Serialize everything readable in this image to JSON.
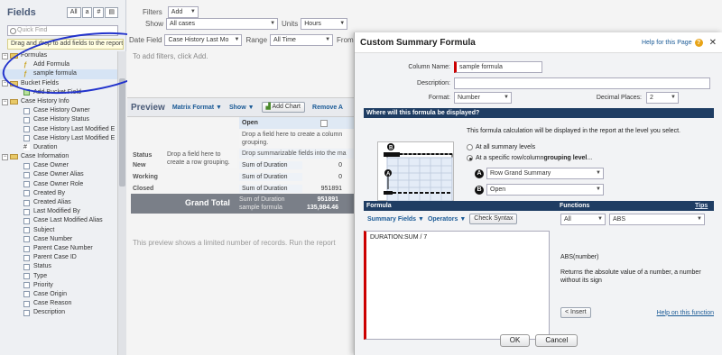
{
  "sidebar": {
    "title": "Fields",
    "filter_buttons": [
      "All",
      "a",
      "#",
      "▤"
    ],
    "quick_find_placeholder": "Quick Find",
    "drag_tip": "Drag and drop to add fields to the report",
    "tree": [
      {
        "label": "Formulas",
        "level": 0,
        "kind": "folder",
        "toggle": "⊟"
      },
      {
        "label": "Add Formula",
        "level": 1,
        "kind": "formula"
      },
      {
        "label": "sample formula",
        "level": 1,
        "kind": "formula",
        "selected": true
      },
      {
        "label": "Bucket Fields",
        "level": 0,
        "kind": "folder",
        "toggle": "⊟"
      },
      {
        "label": "Add Bucket Field",
        "level": 1,
        "kind": "bucket"
      },
      {
        "label": "Case History Info",
        "level": 0,
        "kind": "folder",
        "toggle": "⊟"
      },
      {
        "label": "Case History Owner",
        "level": 1,
        "kind": "field"
      },
      {
        "label": "Case History Status",
        "level": 1,
        "kind": "field"
      },
      {
        "label": "Case History Last Modified E",
        "level": 1,
        "kind": "field"
      },
      {
        "label": "Case History Last Modified E",
        "level": 1,
        "kind": "field"
      },
      {
        "label": "Duration",
        "level": 1,
        "kind": "num"
      },
      {
        "label": "Case Information",
        "level": 0,
        "kind": "folder",
        "toggle": "⊟"
      },
      {
        "label": "Case Owner",
        "level": 1,
        "kind": "field"
      },
      {
        "label": "Case Owner Alias",
        "level": 1,
        "kind": "field"
      },
      {
        "label": "Case Owner Role",
        "level": 1,
        "kind": "field"
      },
      {
        "label": "Created By",
        "level": 1,
        "kind": "field"
      },
      {
        "label": "Created Alias",
        "level": 1,
        "kind": "field"
      },
      {
        "label": "Last Modified By",
        "level": 1,
        "kind": "field"
      },
      {
        "label": "Case Last Modified Alias",
        "level": 1,
        "kind": "field"
      },
      {
        "label": "Subject",
        "level": 1,
        "kind": "field"
      },
      {
        "label": "Case Number",
        "level": 1,
        "kind": "field"
      },
      {
        "label": "Parent Case Number",
        "level": 1,
        "kind": "field"
      },
      {
        "label": "Parent Case ID",
        "level": 1,
        "kind": "field"
      },
      {
        "label": "Status",
        "level": 1,
        "kind": "field"
      },
      {
        "label": "Type",
        "level": 1,
        "kind": "field"
      },
      {
        "label": "Priority",
        "level": 1,
        "kind": "field"
      },
      {
        "label": "Case Origin",
        "level": 1,
        "kind": "field"
      },
      {
        "label": "Case Reason",
        "level": 1,
        "kind": "field"
      },
      {
        "label": "Description",
        "level": 1,
        "kind": "field"
      }
    ]
  },
  "main": {
    "filters_label": "Filters",
    "add_button": "Add",
    "show_label": "Show",
    "show_value": "All cases",
    "units_label": "Units",
    "units_value": "Hours",
    "date_field_label": "Date Field",
    "date_field_value": "Case History Last Mo",
    "range_label": "Range",
    "range_value": "All Time",
    "from_label": "From",
    "filters_hint": "To add filters, click Add.",
    "preview_title": "Preview",
    "format_link": "Matrix Format",
    "show_link": "Show",
    "add_chart": "Add Chart",
    "remove_link": "Remove A",
    "grid": {
      "col_header": "Open",
      "drop_col_hint": "Drop a field here to create a column grouping.",
      "drop_row_hint": "Drop a field here to create a row grouping.",
      "drop_summary_hint": "Drop summarizable fields into the ma",
      "status_label": "Status",
      "rows": [
        {
          "label": "New",
          "summary": "Sum of Duration",
          "value": "0"
        },
        {
          "label": "Working",
          "summary": "Sum of Duration",
          "value": "0"
        },
        {
          "label": "Closed",
          "summary": "Sum of Duration",
          "value": "951891"
        }
      ],
      "grand_total": "Grand Total",
      "gt_line1": "Sum of Duration",
      "gt_line2": "sample formula",
      "gt_val1": "951891",
      "gt_val2": "135,984.46"
    },
    "preview_note": "This preview shows a limited number of records. Run the report"
  },
  "dialog": {
    "title": "Custom Summary Formula",
    "help": "Help for this Page",
    "column_name_label": "Column Name:",
    "column_name_value": "sample formula",
    "description_label": "Description:",
    "description_value": "",
    "format_label": "Format:",
    "format_value": "Number",
    "decimal_label": "Decimal Places:",
    "decimal_value": "2",
    "where_title": "Where will this formula be displayed?",
    "where_desc": "This formula calculation will be displayed in the report at the level you select.",
    "opt_all": "At all summary levels",
    "opt_specific_prefix": "At a specific row/column ",
    "opt_specific_bold": "grouping level",
    "opt_specific_suffix": "...",
    "row_select": "Row Grand Summary",
    "col_select": "Open",
    "badge_a": "A",
    "badge_b": "B",
    "formula_header": "Formula",
    "functions_header": "Functions",
    "tips": "Tips",
    "summary_fields": "Summary Fields",
    "operators": "Operators",
    "check_syntax": "Check Syntax",
    "fn_category": "All",
    "fn_selected": "ABS",
    "formula_text": "DURATION:SUM / 7",
    "fn_signature": "ABS(number)",
    "fn_description": "Returns the absolute value of a number, a number without its sign",
    "insert": "< Insert",
    "help_fn": "Help on this function",
    "ok": "OK",
    "cancel": "Cancel"
  },
  "colors": {
    "accent": "#1f3d63",
    "link": "#1a5a96",
    "required": "#cc0000",
    "annotation_circle": "#2233cc"
  }
}
